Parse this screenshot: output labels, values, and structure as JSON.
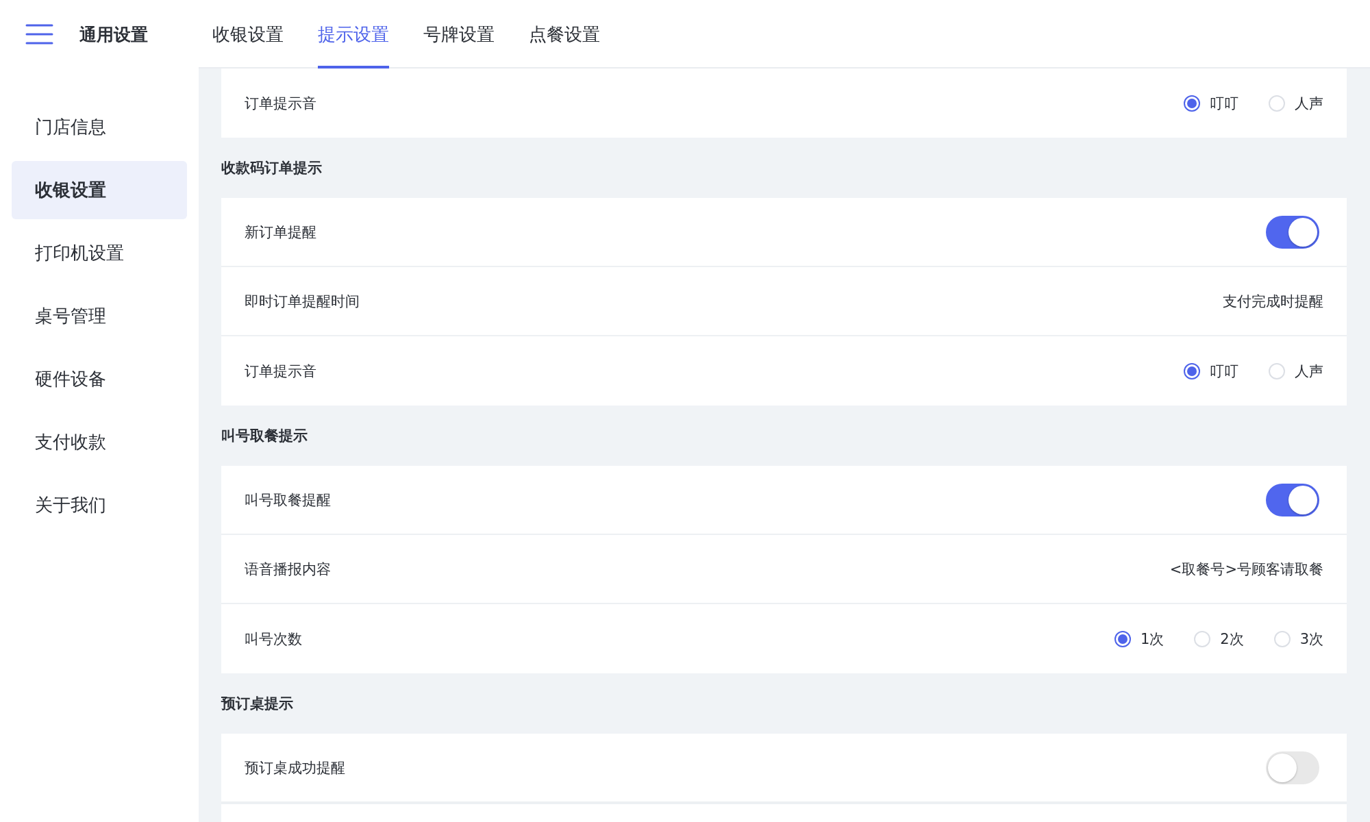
{
  "header": {
    "title": "通用设置",
    "tabs": [
      {
        "label": "收银设置",
        "selected": false
      },
      {
        "label": "提示设置",
        "selected": true
      },
      {
        "label": "号牌设置",
        "selected": false
      },
      {
        "label": "点餐设置",
        "selected": false
      }
    ]
  },
  "sidebar": {
    "items": [
      {
        "label": "门店信息",
        "selected": false
      },
      {
        "label": "收银设置",
        "selected": true
      },
      {
        "label": "打印机设置",
        "selected": false
      },
      {
        "label": "桌号管理",
        "selected": false
      },
      {
        "label": "硬件设备",
        "selected": false
      },
      {
        "label": "支付收款",
        "selected": false
      },
      {
        "label": "关于我们",
        "selected": false
      }
    ]
  },
  "sections": [
    {
      "rows": [
        {
          "kind": "radio",
          "label": "订单提示音",
          "options": [
            {
              "label": "叮叮",
              "selected": true
            },
            {
              "label": "人声",
              "selected": false
            }
          ]
        }
      ]
    },
    {
      "heading": "收款码订单提示",
      "rows": [
        {
          "kind": "toggle",
          "label": "新订单提醒",
          "on": true
        },
        {
          "kind": "value",
          "label": "即时订单提醒时间",
          "value": "支付完成时提醒"
        },
        {
          "kind": "radio",
          "label": "订单提示音",
          "options": [
            {
              "label": "叮叮",
              "selected": true
            },
            {
              "label": "人声",
              "selected": false
            }
          ]
        }
      ]
    },
    {
      "heading": "叫号取餐提示",
      "rows": [
        {
          "kind": "toggle",
          "label": "叫号取餐提醒",
          "on": true
        },
        {
          "kind": "value",
          "label": "语音播报内容",
          "value": "<取餐号>号顾客请取餐"
        },
        {
          "kind": "radio",
          "label": "叫号次数",
          "options": [
            {
              "label": "1次",
              "selected": true
            },
            {
              "label": "2次",
              "selected": false
            },
            {
              "label": "3次",
              "selected": false
            }
          ]
        }
      ]
    },
    {
      "heading": "预订桌提示",
      "rows": [
        {
          "kind": "toggle",
          "label": "预订桌成功提醒",
          "on": false
        }
      ]
    }
  ]
}
